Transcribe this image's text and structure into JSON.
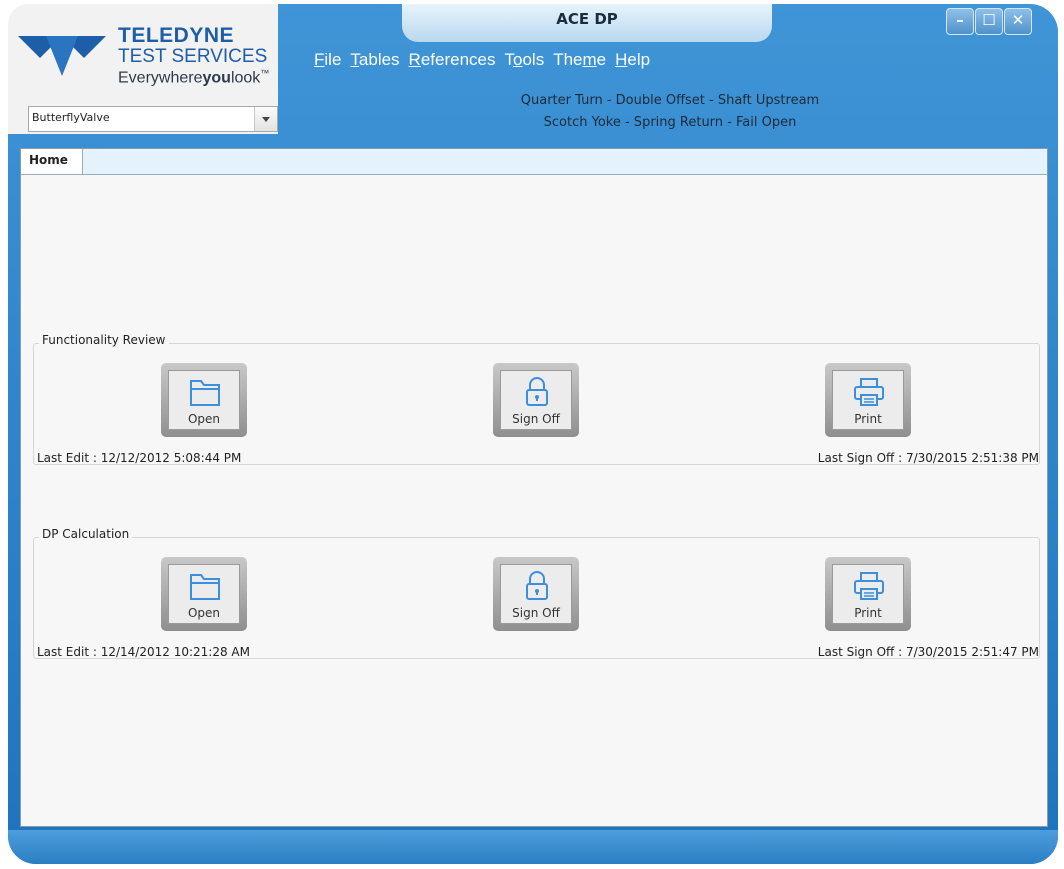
{
  "window": {
    "title": "ACE DP",
    "controls": [
      "–",
      "☐",
      "✕"
    ]
  },
  "logo": {
    "line1": "TELEDYNE",
    "line2": "TEST SERVICES",
    "tagline_part1": "Everywhere",
    "tagline_bold": "you",
    "tagline_part2": "look",
    "tm": "™"
  },
  "menu": {
    "items": [
      {
        "access_key": "F",
        "rest": "ile"
      },
      {
        "access_key": "T",
        "rest": "ables"
      },
      {
        "access_key": "R",
        "rest": "eferences"
      },
      {
        "pre": "T",
        "access_key": "o",
        "rest": "ols"
      },
      {
        "pre": "The",
        "access_key": "m",
        "rest": "e"
      },
      {
        "access_key": "H",
        "rest": "elp"
      }
    ]
  },
  "valve_select": {
    "value": "ButterflyValve"
  },
  "description": {
    "line1": "Quarter Turn - Double Offset - Shaft Upstream",
    "line2": "Scotch Yoke - Spring Return - Fail Open"
  },
  "tabs": [
    {
      "label": "Home",
      "selected": true
    }
  ],
  "groups": [
    {
      "title": "Functionality Review",
      "open_label": "Open",
      "signoff_label": "Sign Off",
      "print_label": "Print",
      "last_edit": "Last Edit : 12/12/2012 5:08:44 PM",
      "last_signoff": "Last Sign Off : 7/30/2015 2:51:38 PM"
    },
    {
      "title": "DP Calculation",
      "open_label": "Open",
      "signoff_label": "Sign Off",
      "print_label": "Print",
      "last_edit": "Last Edit : 12/14/2012 10:21:28 AM",
      "last_signoff": "Last Sign Off : 7/30/2015 2:51:47 PM"
    }
  ],
  "colors": {
    "window_blue": "#2a7fc4",
    "icon_blue": "#3b8fdc",
    "logo_blue": "#1e5ea8"
  }
}
